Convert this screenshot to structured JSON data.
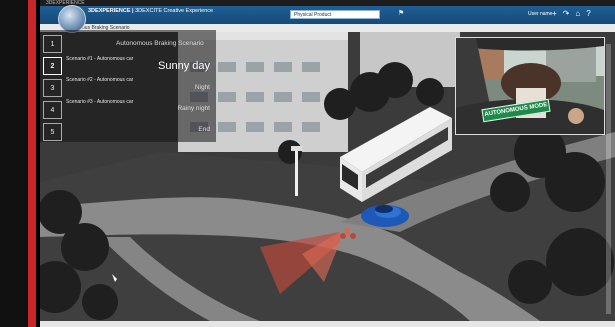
{
  "os_title": "3DEXPERIENCE",
  "header": {
    "brand_main": "3DEXPERIENCE",
    "brand_separator": " | ",
    "brand_sub": "3DEXCITE Creative Experience",
    "search_value": "Physical Product",
    "user": "User name",
    "icons": [
      "add-icon",
      "share-icon",
      "home-icon",
      "help-icon"
    ]
  },
  "breadcrumb": "Autonomous Braking Scenario",
  "scenario": {
    "title": "Autonomous Braking Scenario",
    "steps": [
      {
        "num": "1",
        "name": "",
        "right": ""
      },
      {
        "num": "2",
        "name": "Scenario #1 - Autonomous car",
        "right": "Sunny day",
        "active": true
      },
      {
        "num": "3",
        "name": "Scenario #2 - Autonomous car",
        "right": "Night"
      },
      {
        "num": "4",
        "name": "Scenario #3 - Autonomous car",
        "right": "Rainy night"
      },
      {
        "num": "5",
        "name": "",
        "right": "End"
      }
    ]
  },
  "pip": {
    "sign_text": "AUTONOMOUS MODE"
  },
  "colors": {
    "accent_blue": "#1f5f96",
    "frame_red": "#c8262a",
    "sign_green": "#1e8a4a",
    "car_blue": "#1f59b8"
  }
}
